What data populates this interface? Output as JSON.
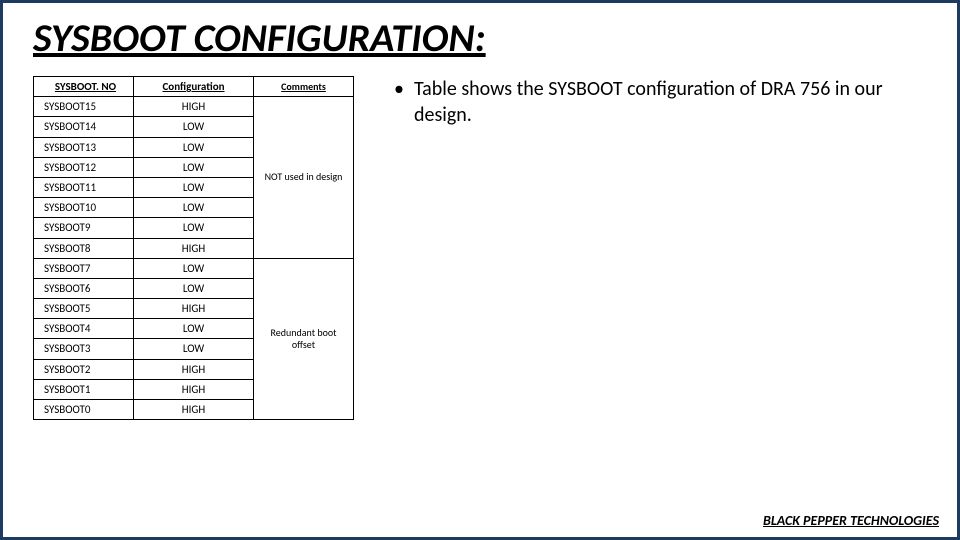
{
  "title": "SYSBOOT CONFIGURATION:",
  "table": {
    "headers": [
      "SYSBOOT. NO",
      "Configuration",
      "Comments"
    ],
    "rows": [
      {
        "no": "SYSBOOT15",
        "cfg": "HIGH"
      },
      {
        "no": "SYSBOOT14",
        "cfg": "LOW"
      },
      {
        "no": "SYSBOOT13",
        "cfg": "LOW"
      },
      {
        "no": "SYSBOOT12",
        "cfg": "LOW"
      },
      {
        "no": "SYSBOOT11",
        "cfg": "LOW"
      },
      {
        "no": "SYSBOOT10",
        "cfg": "LOW"
      },
      {
        "no": "SYSBOOT9",
        "cfg": "LOW"
      },
      {
        "no": "SYSBOOT8",
        "cfg": "HIGH"
      },
      {
        "no": "SYSBOOT7",
        "cfg": "LOW"
      },
      {
        "no": "SYSBOOT6",
        "cfg": "LOW"
      },
      {
        "no": "SYSBOOT5",
        "cfg": "HIGH"
      },
      {
        "no": "SYSBOOT4",
        "cfg": "LOW"
      },
      {
        "no": "SYSBOOT3",
        "cfg": "LOW"
      },
      {
        "no": "SYSBOOT2",
        "cfg": "HIGH"
      },
      {
        "no": "SYSBOOT1",
        "cfg": "HIGH"
      },
      {
        "no": "SYSBOOT0",
        "cfg": "HIGH"
      }
    ],
    "comment_groups": [
      {
        "start": 0,
        "span": 8,
        "text": "NOT used in design"
      },
      {
        "start": 8,
        "span": 8,
        "text": "Redundant boot offset"
      }
    ]
  },
  "bullet": "Table shows the SYSBOOT configuration of DRA 756 in our design.",
  "footer": "BLACK PEPPER TECHNOLOGIES",
  "chart_data": {
    "type": "table",
    "title": "SYSBOOT CONFIGURATION",
    "columns": [
      "SYSBOOT. NO",
      "Configuration",
      "Comments"
    ],
    "rows": [
      [
        "SYSBOOT15",
        "HIGH",
        "NOT used in design"
      ],
      [
        "SYSBOOT14",
        "LOW",
        "NOT used in design"
      ],
      [
        "SYSBOOT13",
        "LOW",
        "NOT used in design"
      ],
      [
        "SYSBOOT12",
        "LOW",
        "NOT used in design"
      ],
      [
        "SYSBOOT11",
        "LOW",
        "NOT used in design"
      ],
      [
        "SYSBOOT10",
        "LOW",
        "NOT used in design"
      ],
      [
        "SYSBOOT9",
        "LOW",
        "NOT used in design"
      ],
      [
        "SYSBOOT8",
        "HIGH",
        "NOT used in design"
      ],
      [
        "SYSBOOT7",
        "LOW",
        "Redundant boot offset"
      ],
      [
        "SYSBOOT6",
        "LOW",
        "Redundant boot offset"
      ],
      [
        "SYSBOOT5",
        "HIGH",
        "Redundant boot offset"
      ],
      [
        "SYSBOOT4",
        "LOW",
        "Redundant boot offset"
      ],
      [
        "SYSBOOT3",
        "LOW",
        "Redundant boot offset"
      ],
      [
        "SYSBOOT2",
        "HIGH",
        "Redundant boot offset"
      ],
      [
        "SYSBOOT1",
        "HIGH",
        "Redundant boot offset"
      ],
      [
        "SYSBOOT0",
        "HIGH",
        "Redundant boot offset"
      ]
    ]
  }
}
